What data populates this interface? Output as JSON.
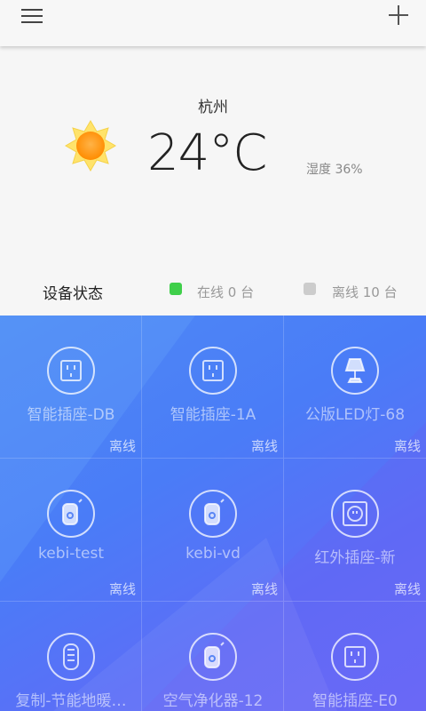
{
  "header": {
    "menu_icon": "hamburger-menu-icon",
    "add_icon": "plus-icon"
  },
  "weather": {
    "city": "杭州",
    "icon": "sun-icon",
    "temperature": "24°C",
    "humidity": "湿度 36%"
  },
  "status": {
    "title": "设备状态",
    "online": {
      "text": "在线 0 台",
      "color": "#3fcf4a"
    },
    "offline": {
      "text": "离线 10 台",
      "color": "#cccccc"
    }
  },
  "devices": [
    {
      "name": "智能插座-DB",
      "state": "离线",
      "icon": "smart-socket-icon"
    },
    {
      "name": "智能插座-1A",
      "state": "离线",
      "icon": "smart-socket-icon"
    },
    {
      "name": "公版LED灯-68",
      "state": "离线",
      "icon": "lamp-icon"
    },
    {
      "name": "kebi-test",
      "state": "离线",
      "icon": "remote-control-icon"
    },
    {
      "name": "kebi-vd",
      "state": "离线",
      "icon": "remote-control-icon"
    },
    {
      "name": "红外插座-新",
      "state": "离线",
      "icon": "infrared-socket-icon"
    },
    {
      "name": "复制-节能地暖…",
      "state": "",
      "icon": "heater-icon"
    },
    {
      "name": "空气净化器-12",
      "state": "",
      "icon": "remote-control-icon"
    },
    {
      "name": "智能插座-E0",
      "state": "",
      "icon": "smart-socket-icon"
    }
  ],
  "colors": {
    "grid_start": "#4e8af5",
    "grid_end": "#6a6cf8",
    "sun": "#ff9c1a"
  }
}
